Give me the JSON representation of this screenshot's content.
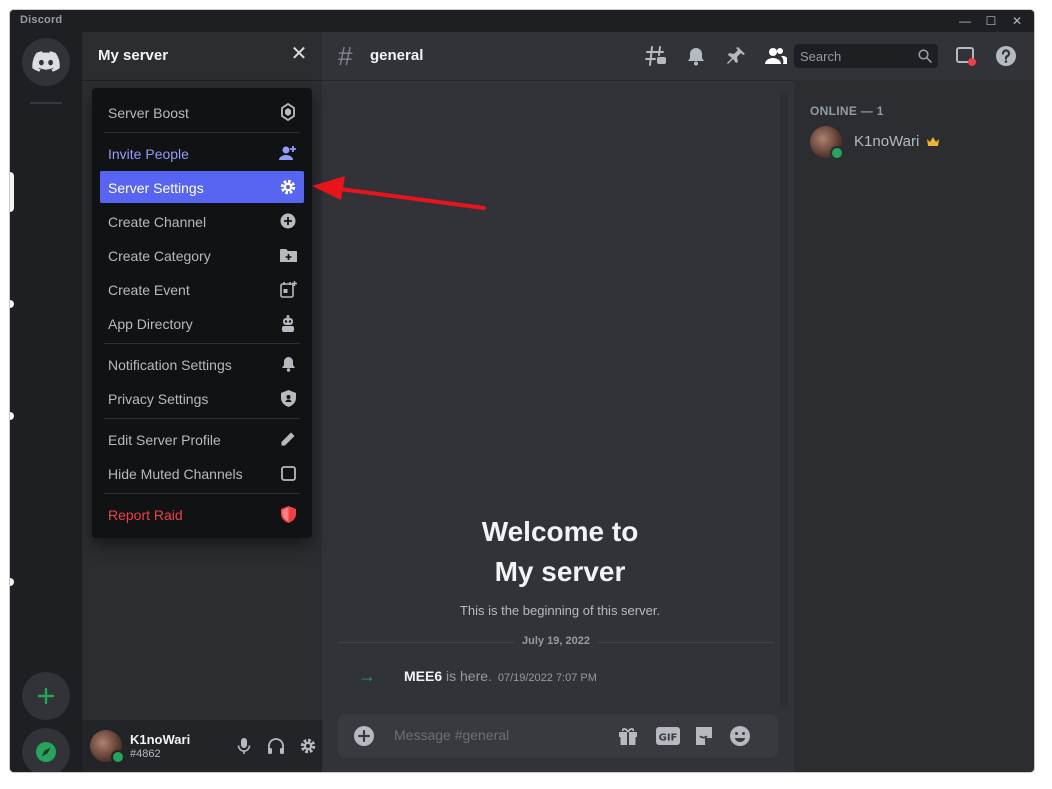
{
  "window": {
    "app_name": "Discord",
    "minimize": "—",
    "maximize": "☐",
    "close": "✕"
  },
  "server": {
    "name": "My server",
    "close_glyph": "✕"
  },
  "context_menu": {
    "items": [
      {
        "label": "Server Boost",
        "icon": "boost-icon"
      },
      {
        "label": "Invite People",
        "icon": "invite-icon"
      },
      {
        "label": "Server Settings",
        "icon": "gear-icon"
      },
      {
        "label": "Create Channel",
        "icon": "plus-circle-icon"
      },
      {
        "label": "Create Category",
        "icon": "folder-plus-icon"
      },
      {
        "label": "Create Event",
        "icon": "calendar-plus-icon"
      },
      {
        "label": "App Directory",
        "icon": "robot-icon"
      },
      {
        "label": "Notification Settings",
        "icon": "bell-icon"
      },
      {
        "label": "Privacy Settings",
        "icon": "shield-icon"
      },
      {
        "label": "Edit Server Profile",
        "icon": "pencil-icon"
      },
      {
        "label": "Hide Muted Channels",
        "icon": "checkbox-icon"
      },
      {
        "label": "Report Raid",
        "icon": "shield-alert-icon"
      }
    ],
    "active": "Server Settings"
  },
  "channel": {
    "hash": "#",
    "name": "general",
    "search_placeholder": "Search"
  },
  "chat": {
    "welcome_line1": "Welcome to",
    "welcome_line2": "My server",
    "welcome_sub": "This is the beginning of this server.",
    "divider_date": "July 19, 2022",
    "join": {
      "arrow": "→",
      "user": "MEE6",
      "text": " is here.",
      "time": "07/19/2022 7:07 PM"
    },
    "composer_placeholder": "Message #general"
  },
  "members": {
    "heading": "ONLINE — 1",
    "list": [
      {
        "name": "K1noWari",
        "badge": "crown-icon"
      }
    ]
  },
  "user": {
    "name": "K1noWari",
    "tag": "#4862"
  },
  "colors": {
    "accent": "#5865f2",
    "online": "#23a55a",
    "danger": "#f23f43",
    "annotation": "#e8141b"
  }
}
